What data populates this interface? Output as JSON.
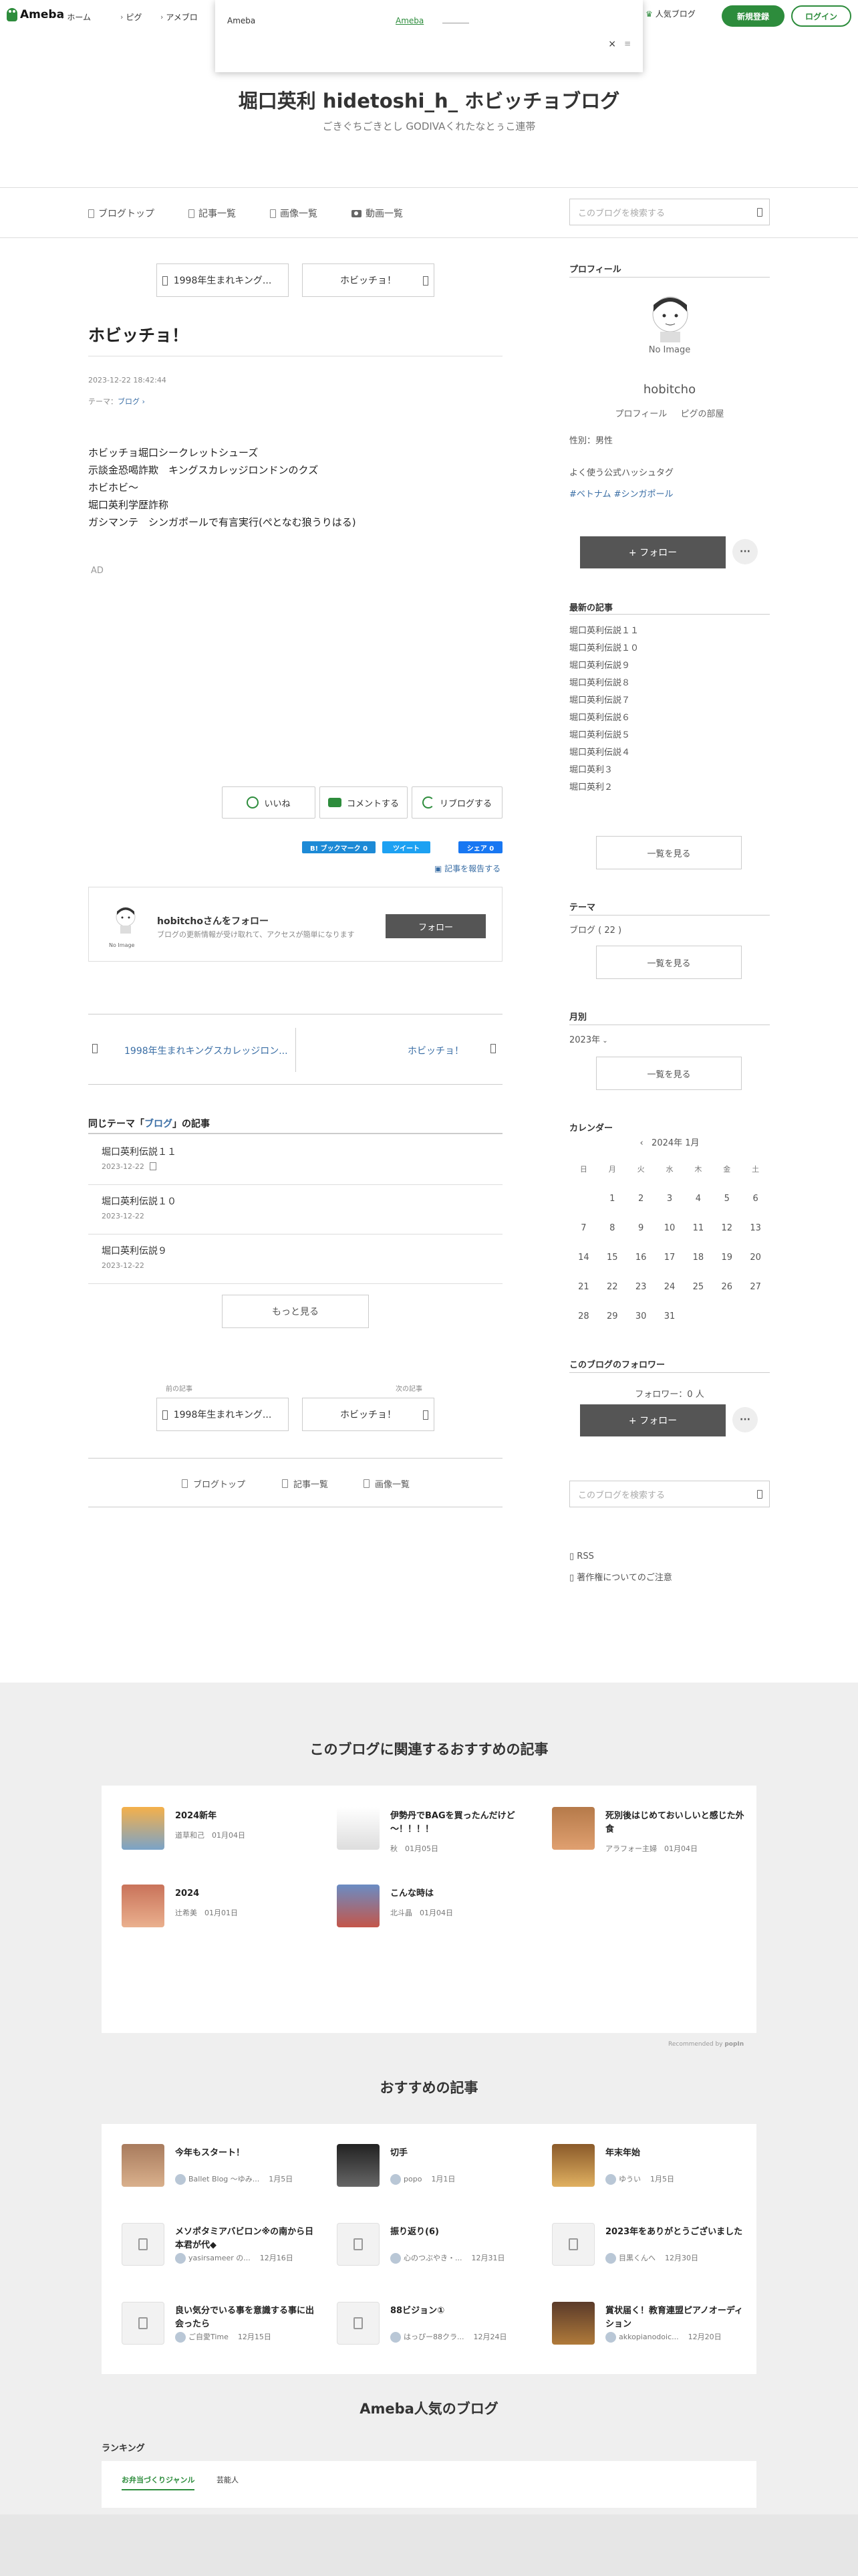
{
  "header": {
    "logo": "Ameba",
    "nav": [
      "ホーム",
      "ピグ",
      "アメブロ"
    ],
    "popup": {
      "text": "Ameba",
      "link": "Ameba",
      "close": "×"
    },
    "popular_blog": "人気ブログ",
    "register": "新規登録",
    "login": "ログイン"
  },
  "blog": {
    "title": "堀口英利 hidetoshi_h_ ホビッチョブログ",
    "description": "ごきぐちごきとし GODIVAくれたなとぅこ連帯",
    "gnav": [
      "ブログトップ",
      "記事一覧",
      "画像一覧",
      "動画一覧"
    ],
    "search_placeholder": "このブログを検索する"
  },
  "article": {
    "prev_btn": "1998年生まれキング...",
    "next_btn": "ホビッチョ！",
    "title": "ホビッチョ！",
    "date": "2023-12-22 18:42:44",
    "theme_label": "テーマ：",
    "theme": "ブログ",
    "body": [
      "ホビッチョ堀口シークレットシューズ",
      "示談金恐喝詐欺　キングスカレッジロンドンのクズ",
      "ホビホビ〜",
      "堀口英利学歴詐称",
      "ガシマンテ　シンガポールで有言実行(ぺとなむ狼うりはる)"
    ],
    "ad": "AD",
    "like": "いいね",
    "comment": "コメントする",
    "reblog": "リブログする",
    "bookmark": "B! ブックマーク 0",
    "tweet": "ツイート",
    "fb_share": "シェア 0",
    "report": "記事を報告する",
    "follow_title": "hobitchoさんをフォロー",
    "follow_sub": "ブログの更新情報が受け取れて、アクセスが簡単になります",
    "follow_btn": "フォロー",
    "noimage": "No Image",
    "prev_link": "1998年生まれキングスカレッジロン...",
    "next_link": "ホビッチョ！",
    "related_prefix": "同じテーマ「",
    "related_theme": "ブログ",
    "related_suffix": "」の記事",
    "related": [
      {
        "title": "堀口英利伝説１１",
        "date": "2023-12-22"
      },
      {
        "title": "堀口英利伝説１０",
        "date": "2023-12-22"
      },
      {
        "title": "堀口英利伝説９",
        "date": "2023-12-22"
      }
    ],
    "more": "もっと見る",
    "prev_label": "前の記事",
    "next_label": "次の記事",
    "footer_links": [
      "ブログトップ",
      "記事一覧",
      "画像一覧"
    ]
  },
  "sidebar": {
    "profile_heading": "プロフィール",
    "noimage": "No Image",
    "name": "hobitcho",
    "profile_links": [
      "プロフィール",
      "ピグの部屋"
    ],
    "gender": "性別：男性",
    "hashtag_heading": "よく使う公式ハッシュタグ",
    "hashtags": [
      "#ベトナム",
      "#シンガポール"
    ],
    "follow": "+ フォロー",
    "dots": "···",
    "recent_heading": "最新の記事",
    "recent": [
      "堀口英利伝説１１",
      "堀口英利伝説１０",
      "堀口英利伝説９",
      "堀口英利伝説８",
      "堀口英利伝説７",
      "堀口英利伝説６",
      "堀口英利伝説５",
      "堀口英利伝説４",
      "堀口英利３",
      "堀口英利２"
    ],
    "see_all": "一覧を見る",
    "theme_heading": "テーマ",
    "theme_item": "ブログ ( 22 )",
    "month_heading": "月別",
    "month_item": "2023年",
    "calendar_heading": "カレンダー",
    "calendar_month": "2024年 1月",
    "weekdays": [
      "日",
      "月",
      "火",
      "水",
      "木",
      "金",
      "土"
    ],
    "weeks": [
      [
        "",
        "1",
        "2",
        "3",
        "4",
        "5",
        "6"
      ],
      [
        "7",
        "8",
        "9",
        "10",
        "11",
        "12",
        "13"
      ],
      [
        "14",
        "15",
        "16",
        "17",
        "18",
        "19",
        "20"
      ],
      [
        "21",
        "22",
        "23",
        "24",
        "25",
        "26",
        "27"
      ],
      [
        "28",
        "29",
        "30",
        "31",
        "",
        "",
        ""
      ]
    ],
    "followers_heading": "このブログのフォロワー",
    "followers_count": "フォロワー：0 人",
    "rss": "RSS",
    "copyright": "著作権についてのご注意"
  },
  "recommend": {
    "related_title": "このブログに関連するおすすめの記事",
    "related_cards": [
      {
        "title": "2024新年",
        "meta": "道草和己　01月04日"
      },
      {
        "title": "伊勢丹でBAGを買ったんだけど～！！！！",
        "meta": "秋　01月05日"
      },
      {
        "title": "死別後はじめておいしいと感じた外食",
        "meta": "アラフォー主婦　01月04日"
      },
      {
        "title": "2024",
        "meta": "辻希美　01月01日"
      },
      {
        "title": "こんな時は",
        "meta": "北斗晶　01月04日"
      }
    ],
    "powered": "Recommended by",
    "osusume_title": "おすすめの記事",
    "osusume_cards": [
      {
        "title": "今年もスタート！",
        "author": "Ballet Blog ～ゆみ...",
        "date": "1月5日"
      },
      {
        "title": "切手",
        "author": "popo",
        "date": "1月1日"
      },
      {
        "title": "年末年始",
        "author": "ゆうい",
        "date": "1月5日"
      },
      {
        "title": "メソポタミアバビロン※の南から日本君が代◆",
        "author": "yasirsameer の...",
        "date": "12月16日"
      },
      {
        "title": "振り返り(6)",
        "author": "心のつぶやき・...",
        "date": "12月31日"
      },
      {
        "title": "2023年をありがとうございました",
        "author": "目黒くんへ",
        "date": "12月30日"
      },
      {
        "title": "良い気分でいる事を意識する事に出会ったら",
        "author": "ご自愛Time",
        "date": "12月15日"
      },
      {
        "title": "88ビジョン①",
        "author": "はっぴー88クラ...",
        "date": "12月24日"
      },
      {
        "title": "賞状届く！教育連盟ピアノオーディション",
        "author": "akkopianodoic...",
        "date": "12月20日"
      }
    ],
    "popular_title": "Ameba人気のブログ",
    "ranking": "ランキング",
    "rank_tabs": [
      "お弁当づくりジャンル",
      "芸能人"
    ]
  },
  "colors": {
    "brand": "#2d8c3c",
    "link": "#3a6ea5"
  }
}
